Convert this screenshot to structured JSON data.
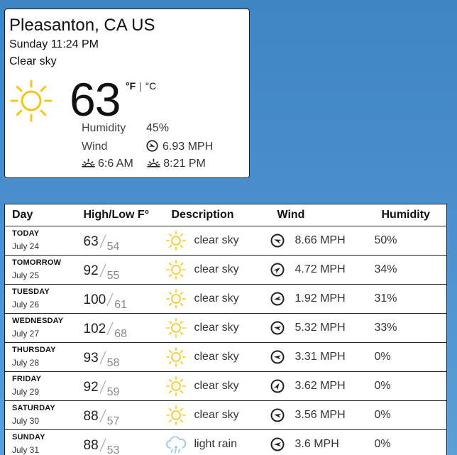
{
  "current": {
    "location": "Pleasanton, CA US",
    "datetime": "Sunday 11:24 PM",
    "description": "Clear sky",
    "icon": "sun-icon",
    "temperature": "63",
    "unit_f": "°F",
    "unit_sep": "|",
    "unit_c": "°C",
    "humidity_label": "Humidity",
    "humidity_value": "45%",
    "wind_label": "Wind",
    "wind_value": "6.93 MPH",
    "sunrise": "6:6 AM",
    "sunset": "8:21 PM"
  },
  "forecast": {
    "headers": {
      "day": "Day",
      "highlow": "High/Low F°",
      "description": "Description",
      "wind": "Wind",
      "humidity": "Humidity"
    },
    "rows": [
      {
        "day": "TODAY",
        "date": "July 24",
        "high": "63",
        "low": "54",
        "icon": "sun-icon",
        "description": "clear sky",
        "wind": "8.66 MPH",
        "humidity": "50%"
      },
      {
        "day": "TOMORROW",
        "date": "July 25",
        "high": "92",
        "low": "55",
        "icon": "sun-icon",
        "description": "clear sky",
        "wind": "4.72 MPH",
        "humidity": "34%"
      },
      {
        "day": "TUESDAY",
        "date": "July 26",
        "high": "100",
        "low": "61",
        "icon": "sun-icon",
        "description": "clear sky",
        "wind": "1.92 MPH",
        "humidity": "31%"
      },
      {
        "day": "WEDNESDAY",
        "date": "July 27",
        "high": "102",
        "low": "68",
        "icon": "sun-icon",
        "description": "clear sky",
        "wind": "5.32 MPH",
        "humidity": "33%"
      },
      {
        "day": "THURSDAY",
        "date": "July 28",
        "high": "93",
        "low": "58",
        "icon": "sun-icon",
        "description": "clear sky",
        "wind": "3.31 MPH",
        "humidity": "0%"
      },
      {
        "day": "FRIDAY",
        "date": "July 29",
        "high": "92",
        "low": "59",
        "icon": "sun-icon",
        "description": "clear sky",
        "wind": "3.62 MPH",
        "humidity": "0%"
      },
      {
        "day": "SATURDAY",
        "date": "July 30",
        "high": "88",
        "low": "57",
        "icon": "sun-icon",
        "description": "clear sky",
        "wind": "3.56 MPH",
        "humidity": "0%"
      },
      {
        "day": "SUNDAY",
        "date": "July 31",
        "high": "88",
        "low": "53",
        "icon": "rain-cloud-icon",
        "description": "light rain",
        "wind": "3.6 MPH",
        "humidity": "0%"
      }
    ]
  },
  "colors": {
    "sun": "#f5c518",
    "rain": "#8ec3e6",
    "background": "#4a8fcc"
  }
}
